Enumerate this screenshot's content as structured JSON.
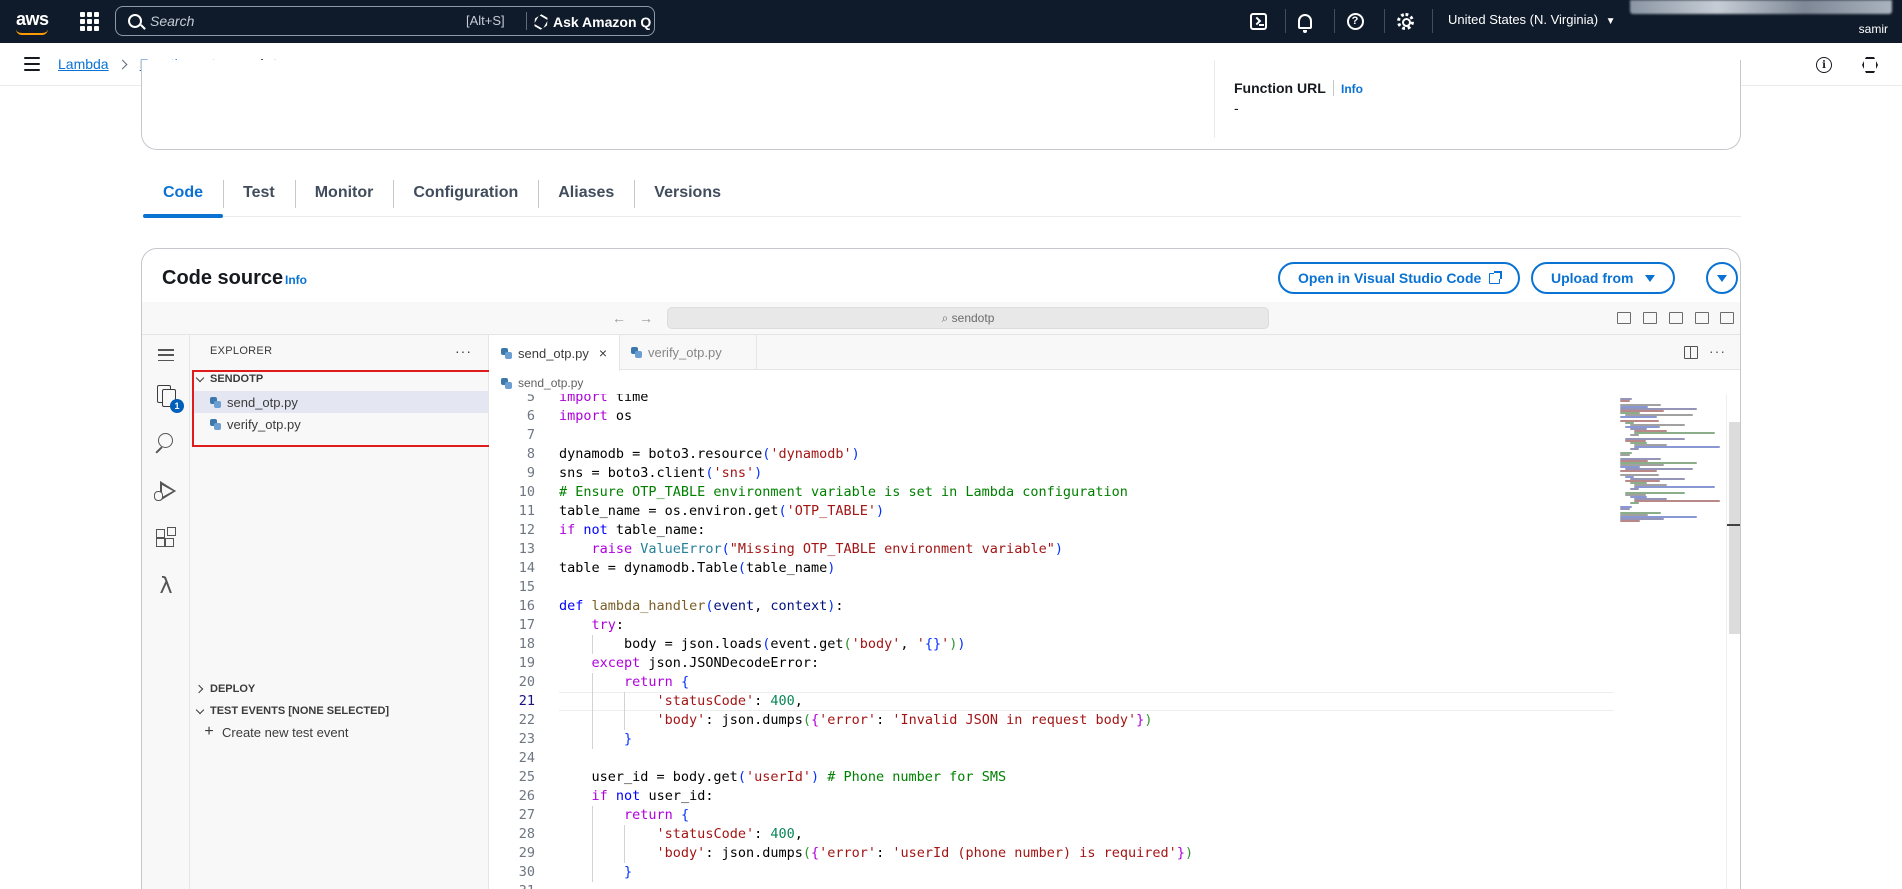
{
  "topnav": {
    "logo_text": "aws",
    "search_placeholder": "Search",
    "search_shortcut": "[Alt+S]",
    "ask_q_label": "Ask Amazon Q",
    "region_label": "United States (N. Virginia)",
    "region_caret": "▼",
    "username": "samir"
  },
  "breadcrumb": {
    "items": [
      "Lambda",
      "Functions"
    ],
    "current": "sendotp"
  },
  "overview": {
    "function_url_label": "Function URL",
    "function_url_info": "Info",
    "function_url_value": "-"
  },
  "tabs": [
    "Code",
    "Test",
    "Monitor",
    "Configuration",
    "Aliases",
    "Versions"
  ],
  "code_source": {
    "title": "Code source",
    "info_label": "Info",
    "open_vscode_label": "Open in Visual Studio Code",
    "upload_from_label": "Upload from"
  },
  "ide": {
    "command_center": "⌕ sendotp",
    "explorer_title": "EXPLORER",
    "more_label": "···",
    "files_badge": "1",
    "folder_name": "SENDOTP",
    "files": [
      "send_otp.py",
      "verify_otp.py"
    ],
    "deploy_label": "DEPLOY",
    "test_events_label": "TEST EVENTS [NONE SELECTED]",
    "create_test_label": "Create new test event",
    "editor_tabs": [
      "send_otp.py",
      "verify_otp.py"
    ],
    "close_glyph": "×",
    "breadcrumb_file": "send_otp.py",
    "current_line": 21
  },
  "code_lines": [
    {
      "n": "5",
      "html": "<span class=\"kc\">import</span> time"
    },
    {
      "n": "6",
      "html": "<span class=\"kc\">import</span> os"
    },
    {
      "n": "7",
      "html": ""
    },
    {
      "n": "8",
      "html": "dynamodb = boto3.resource<span class=\"b\">(</span><span class=\"s\">'dynamodb'</span><span class=\"b\">)</span>"
    },
    {
      "n": "9",
      "html": "sns = boto3.client<span class=\"b\">(</span><span class=\"s\">'sns'</span><span class=\"b\">)</span>"
    },
    {
      "n": "10",
      "html": "<span class=\"c\"># Ensure OTP_TABLE environment variable is set in Lambda configuration</span>"
    },
    {
      "n": "11",
      "html": "table_name = os.environ.get<span class=\"b\">(</span><span class=\"s\">'OTP_TABLE'</span><span class=\"b\">)</span>"
    },
    {
      "n": "12",
      "html": "<span class=\"kc\">if</span> <span class=\"k\">not</span> table_name:"
    },
    {
      "n": "13",
      "html": "    <span class=\"kc\">raise</span> <span class=\"cl\">ValueError</span><span class=\"b\">(</span><span class=\"s\">\"Missing OTP_TABLE environment variable\"</span><span class=\"b\">)</span>"
    },
    {
      "n": "14",
      "html": "table = dynamodb.Table<span class=\"b\">(</span>table_name<span class=\"b\">)</span>"
    },
    {
      "n": "15",
      "html": ""
    },
    {
      "n": "16",
      "html": "<span class=\"k\">def</span> <span class=\"f\">lambda_handler</span><span class=\"b\">(</span><span class=\"p\">event</span>, <span class=\"p\">context</span><span class=\"b\">)</span>:"
    },
    {
      "n": "17",
      "html": "    <span class=\"kc\">try</span>:"
    },
    {
      "n": "18",
      "html": "        body = json.loads<span class=\"b\">(</span>event.get<span class=\"br\">(</span><span class=\"s\">'body'</span>, <span class=\"s\">'</span><span class=\"b\">{}</span><span class=\"s\">'</span><span class=\"br\">)</span><span class=\"b\">)</span>"
    },
    {
      "n": "19",
      "html": "    <span class=\"kc\">except</span> json.JSONDecodeError:"
    },
    {
      "n": "20",
      "html": "        <span class=\"kc\">return</span> <span class=\"b\">{</span>"
    },
    {
      "n": "21",
      "html": "            <span class=\"s\">'statusCode'</span>: <span class=\"n\">400</span>,"
    },
    {
      "n": "22",
      "html": "            <span class=\"s\">'body'</span>: json.dumps<span class=\"br\">(</span><span class=\"kc\">{</span><span class=\"s\">'error'</span>: <span class=\"s\">'Invalid JSON in request body'</span><span class=\"kc\">}</span><span class=\"br\">)</span>"
    },
    {
      "n": "23",
      "html": "        <span class=\"b\">}</span>"
    },
    {
      "n": "24",
      "html": ""
    },
    {
      "n": "25",
      "html": "    user_id = body.get<span class=\"b\">(</span><span class=\"s\">'userId'</span><span class=\"b\">)</span> <span class=\"c\"># Phone number for SMS</span>"
    },
    {
      "n": "26",
      "html": "    <span class=\"kc\">if</span> <span class=\"k\">not</span> user_id:"
    },
    {
      "n": "27",
      "html": "        <span class=\"kc\">return</span> <span class=\"b\">{</span>"
    },
    {
      "n": "28",
      "html": "            <span class=\"s\">'statusCode'</span>: <span class=\"n\">400</span>,"
    },
    {
      "n": "29",
      "html": "            <span class=\"s\">'body'</span>: json.dumps<span class=\"br\">(</span><span class=\"kc\">{</span><span class=\"s\">'error'</span>: <span class=\"s\">'userId (phone number) is required'</span><span class=\"kc\">}</span><span class=\"br\">)</span>"
    },
    {
      "n": "30",
      "html": "        <span class=\"b\">}</span>"
    },
    {
      "n": "31",
      "html": ""
    }
  ],
  "colors": {
    "aws_nav": "#0f1b2a",
    "link_blue": "#0972d3",
    "highlight_red": "#e01b1b",
    "aws_orange": "#ff9900"
  }
}
